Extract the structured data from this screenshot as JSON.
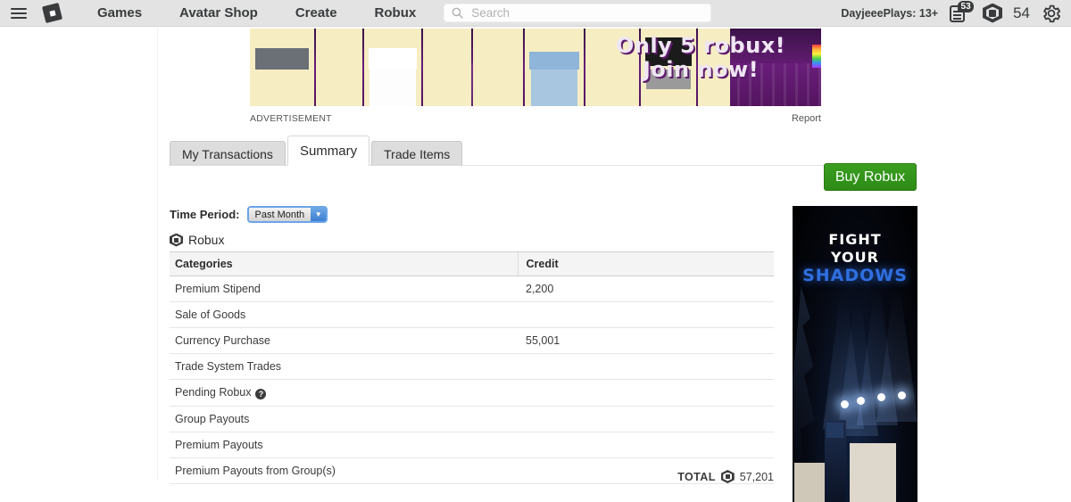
{
  "topnav": {
    "menu_icon": "hamburger-icon",
    "logo_icon": "roblox-logo-icon",
    "links": [
      {
        "label": "Games"
      },
      {
        "label": "Avatar Shop"
      },
      {
        "label": "Create"
      },
      {
        "label": "Robux"
      }
    ],
    "search": {
      "placeholder": "Search",
      "value": "",
      "icon": "search-icon"
    },
    "username": "DayjeeePlays: 13+",
    "messages": {
      "icon": "messages-icon",
      "badge": "53"
    },
    "robux": {
      "icon": "robux-icon",
      "amount": "54"
    },
    "settings_icon": "gear-icon"
  },
  "top_ad": {
    "headline_line1": "Only 5 robux!",
    "headline_line2": "Join now!",
    "label": "ADVERTISEMENT",
    "report_label": "Report"
  },
  "tabs": [
    {
      "label": "My Transactions",
      "active": false
    },
    {
      "label": "Summary",
      "active": true
    },
    {
      "label": "Trade Items",
      "active": false
    }
  ],
  "buy_robux_label": "Buy Robux",
  "filters": {
    "time_period_label": "Time Period:",
    "time_period_value": "Past Month",
    "dropdown_arrow_icon": "chevron-down-icon"
  },
  "currency": {
    "icon": "robux-icon",
    "name": "Robux"
  },
  "table": {
    "headers": {
      "categories": "Categories",
      "credit": "Credit"
    },
    "rows": [
      {
        "category": "Premium Stipend",
        "credit": "2,200",
        "help": false
      },
      {
        "category": "Sale of Goods",
        "credit": "",
        "help": false
      },
      {
        "category": "Currency Purchase",
        "credit": "55,001",
        "help": false
      },
      {
        "category": "Trade System Trades",
        "credit": "",
        "help": false
      },
      {
        "category": "Pending Robux",
        "credit": "",
        "help": true
      },
      {
        "category": "Group Payouts",
        "credit": "",
        "help": false
      },
      {
        "category": "Premium Payouts",
        "credit": "",
        "help": false
      },
      {
        "category": "Premium Payouts from Group(s)",
        "credit": "",
        "help": false
      }
    ],
    "total_label": "TOTAL",
    "total_value": "57,201",
    "total_icon": "robux-icon",
    "help_glyph": "?"
  },
  "side_ad": {
    "line1": "FIGHT",
    "line2": "YOUR",
    "line3": "SHADOWS"
  },
  "colors": {
    "nav_background": "#e3e3e3",
    "buy_button_green": "#2d8b16",
    "accent_blue": "#3c7fd0",
    "shadows_blue": "#2f6fe0",
    "page_background": "#ffffff"
  }
}
